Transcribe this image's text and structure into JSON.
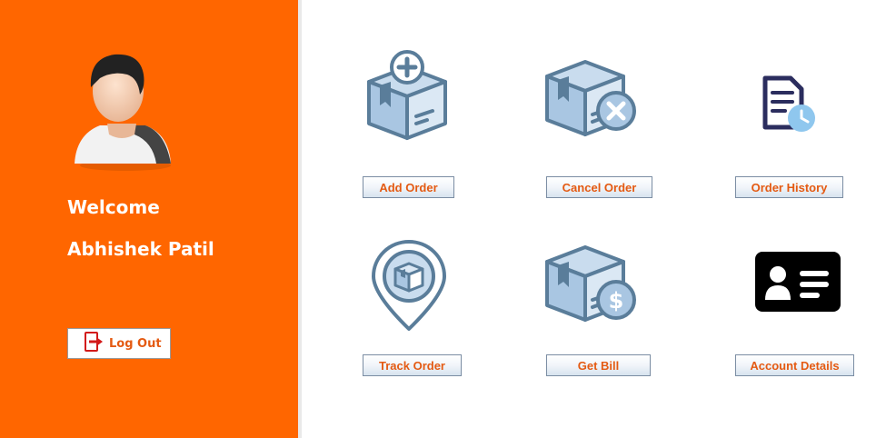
{
  "sidebar": {
    "welcome": "Welcome",
    "username": "Abhishek Patil",
    "logout_label": "Log Out"
  },
  "actions": [
    {
      "label": "Add Order",
      "icon": "add-order-icon"
    },
    {
      "label": "Cancel Order",
      "icon": "cancel-order-icon"
    },
    {
      "label": "Order History",
      "icon": "order-history-icon"
    },
    {
      "label": "Track Order",
      "icon": "track-order-icon"
    },
    {
      "label": "Get Bill",
      "icon": "get-bill-icon"
    },
    {
      "label": "Account Details",
      "icon": "account-details-icon"
    }
  ],
  "colors": {
    "sidebar": "#ff6600",
    "button_text": "#e45a12",
    "icon_stroke": "#5a7d9a",
    "icon_fill": "#a9c6e2"
  }
}
